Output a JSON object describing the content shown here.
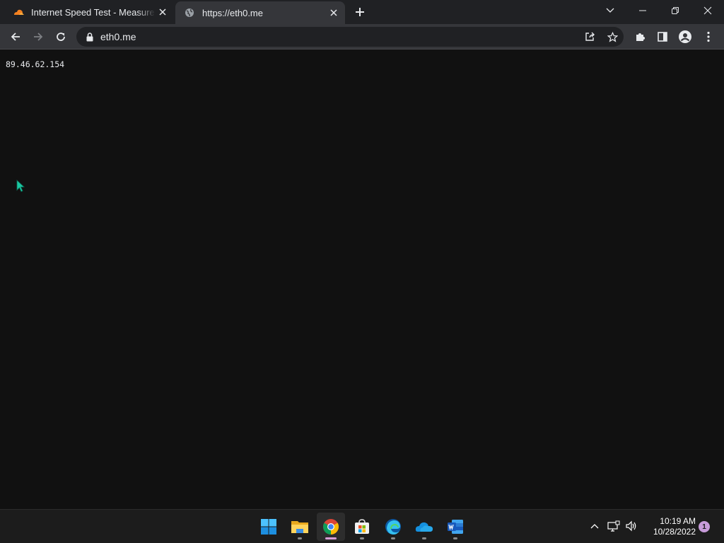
{
  "browser": {
    "tabs": [
      {
        "title": "Internet Speed Test - Measure Network Performance | Cloudflare",
        "favicon": "cloudflare-icon",
        "active": false
      },
      {
        "title": "https://eth0.me",
        "favicon": "globe-icon",
        "active": true
      }
    ],
    "address_bar": {
      "url": "eth0.me",
      "icon": "lock-icon"
    },
    "toolbar_icons": [
      "back-icon",
      "forward-icon",
      "reload-icon",
      "share-icon",
      "bookmark-star-icon",
      "extensions-icon",
      "side-panel-icon",
      "profile-icon",
      "menu-icon"
    ],
    "window_controls": [
      "tab-search-icon",
      "minimize-icon",
      "restore-icon",
      "close-icon"
    ]
  },
  "page": {
    "ip_address": "89.46.62.154"
  },
  "taskbar": {
    "apps": [
      {
        "name": "Start",
        "icon": "windows-start-icon"
      },
      {
        "name": "File Explorer",
        "icon": "file-explorer-icon"
      },
      {
        "name": "Google Chrome",
        "icon": "chrome-icon",
        "active": true
      },
      {
        "name": "Microsoft Store",
        "icon": "store-icon"
      },
      {
        "name": "Microsoft Edge",
        "icon": "edge-icon"
      },
      {
        "name": "OneDrive",
        "icon": "onedrive-icon"
      },
      {
        "name": "Word",
        "icon": "word-icon"
      }
    ],
    "tray_icons": [
      "chevron-up-icon",
      "network-icon",
      "volume-icon"
    ],
    "clock": {
      "time": "10:19 AM",
      "date": "10/28/2022"
    },
    "notification_count": "1"
  },
  "colors": {
    "page_background": "#111111",
    "tabstrip": "#202124",
    "toolbar": "#35363a",
    "taskbar": "#1c1c1c",
    "cloudflare_orange": "#f48120",
    "notification_badge": "#c79bd9"
  }
}
